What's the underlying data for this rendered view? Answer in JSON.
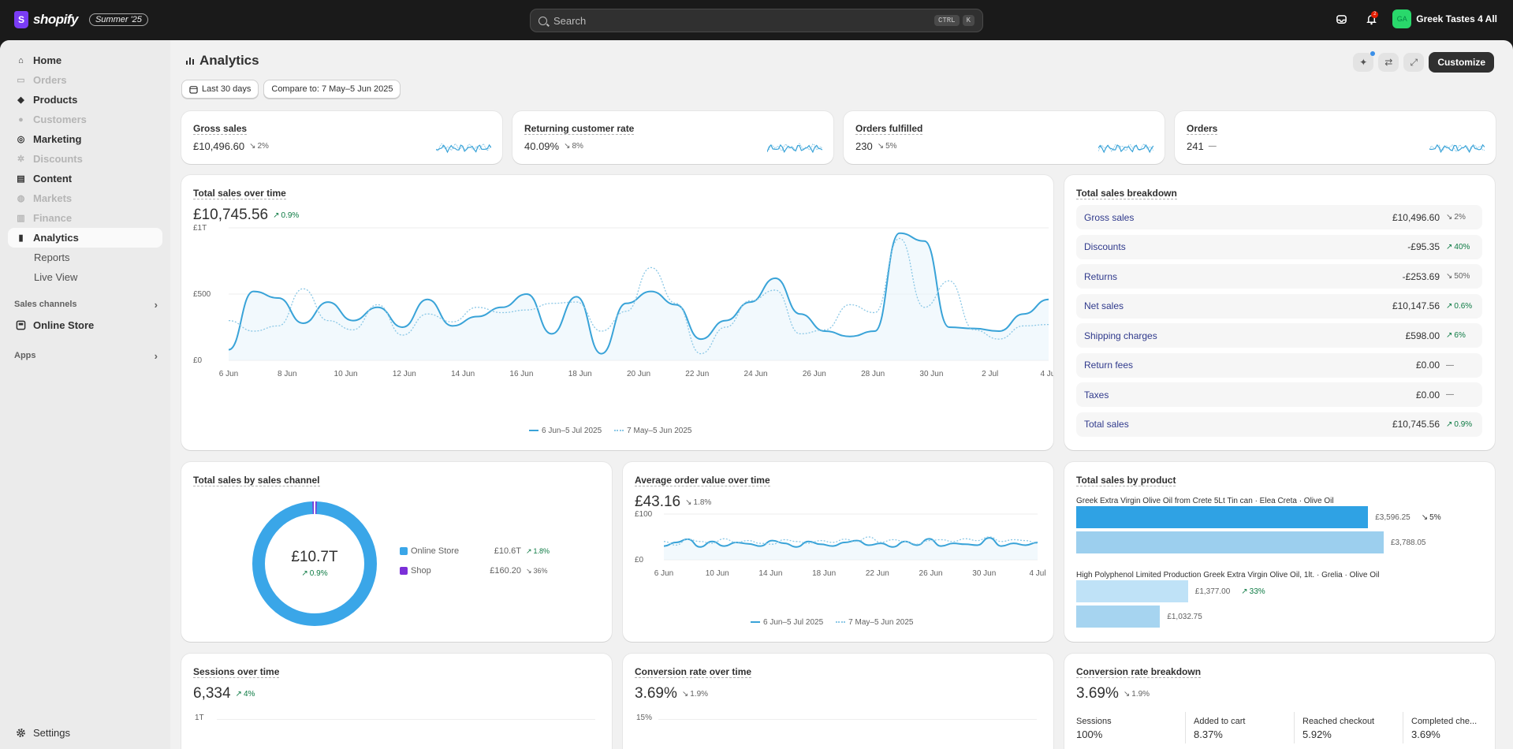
{
  "app": {
    "brand": "shopify",
    "edition": "Summer '25",
    "logo_letter": "S"
  },
  "search": {
    "placeholder": "Search",
    "kbd1": "CTRL",
    "kbd2": "K"
  },
  "topbar": {
    "notif_count": "2",
    "avatar": "GA",
    "store": "Greek Tastes 4 All"
  },
  "sidebar": {
    "items": [
      {
        "label": "Home",
        "icon": "home-icon",
        "dim": false
      },
      {
        "label": "Orders",
        "icon": "orders-icon",
        "dim": true
      },
      {
        "label": "Products",
        "icon": "tag-icon",
        "dim": false
      },
      {
        "label": "Customers",
        "icon": "person-icon",
        "dim": true
      },
      {
        "label": "Marketing",
        "icon": "target-icon",
        "dim": false
      },
      {
        "label": "Discounts",
        "icon": "discount-icon",
        "dim": true
      },
      {
        "label": "Content",
        "icon": "content-icon",
        "dim": false
      },
      {
        "label": "Markets",
        "icon": "globe-icon",
        "dim": true
      },
      {
        "label": "Finance",
        "icon": "bank-icon",
        "dim": true
      },
      {
        "label": "Analytics",
        "icon": "bar-chart-icon",
        "dim": false,
        "active": true
      }
    ],
    "sub": [
      "Reports",
      "Live View"
    ],
    "sales_channels": "Sales channels",
    "online_store": "Online Store",
    "apps": "Apps",
    "settings": "Settings"
  },
  "page": {
    "title": "Analytics",
    "customize": "Customize",
    "date_range": "Last 30 days",
    "compare": "Compare to: 7 May–5 Jun 2025"
  },
  "kpis": [
    {
      "title": "Gross sales",
      "value": "£10,496.60",
      "change": "2%",
      "dir": "down"
    },
    {
      "title": "Returning customer rate",
      "value": "40.09%",
      "change": "8%",
      "dir": "down"
    },
    {
      "title": "Orders fulfilled",
      "value": "230",
      "change": "5%",
      "dir": "down"
    },
    {
      "title": "Orders",
      "value": "241",
      "change": "—",
      "dir": "none"
    }
  ],
  "total_sales": {
    "title": "Total sales over time",
    "value": "£10,745.56",
    "change": "0.9%",
    "y_ticks": [
      "£1T",
      "£500",
      "£0"
    ],
    "x_ticks": [
      "6 Jun",
      "8 Jun",
      "10 Jun",
      "12 Jun",
      "14 Jun",
      "16 Jun",
      "18 Jun",
      "20 Jun",
      "22 Jun",
      "24 Jun",
      "26 Jun",
      "28 Jun",
      "30 Jun",
      "2 Jul",
      "4 Jul"
    ],
    "legend_current": "6 Jun–5 Jul 2025",
    "legend_previous": "7 May–5 Jun 2025"
  },
  "breakdown": {
    "title": "Total sales breakdown",
    "rows": [
      {
        "label": "Gross sales",
        "value": "£10,496.60",
        "change": "2%",
        "dir": "down"
      },
      {
        "label": "Discounts",
        "value": "-£95.35",
        "change": "40%",
        "dir": "up"
      },
      {
        "label": "Returns",
        "value": "-£253.69",
        "change": "50%",
        "dir": "down"
      },
      {
        "label": "Net sales",
        "value": "£10,147.56",
        "change": "0.6%",
        "dir": "up"
      },
      {
        "label": "Shipping charges",
        "value": "£598.00",
        "change": "6%",
        "dir": "up"
      },
      {
        "label": "Return fees",
        "value": "£0.00",
        "change": "—",
        "dir": "none"
      },
      {
        "label": "Taxes",
        "value": "£0.00",
        "change": "—",
        "dir": "none"
      },
      {
        "label": "Total sales",
        "value": "£10,745.56",
        "change": "0.9%",
        "dir": "up"
      }
    ]
  },
  "channel": {
    "title": "Total sales by sales channel",
    "center_value": "£10.7T",
    "center_change": "0.9%",
    "legend": [
      {
        "name": "Online Store",
        "value": "£10.6T",
        "change": "1.8%",
        "dir": "up",
        "color": "#3aa6e8"
      },
      {
        "name": "Shop",
        "value": "£160.20",
        "change": "36%",
        "dir": "down",
        "color": "#7b2fd8"
      }
    ]
  },
  "aov": {
    "title": "Average order value over time",
    "value": "£43.16",
    "change": "1.8%",
    "y_ticks": [
      "£100",
      "£0"
    ],
    "x_ticks": [
      "6 Jun",
      "10 Jun",
      "14 Jun",
      "18 Jun",
      "22 Jun",
      "26 Jun",
      "30 Jun",
      "4 Jul"
    ],
    "legend_current": "6 Jun–5 Jul 2025",
    "legend_previous": "7 May–5 Jun 2025"
  },
  "product": {
    "title": "Total sales by product",
    "items": [
      {
        "name": "Greek Extra Virgin Olive Oil from Crete 5Lt Tin can · Elea Creta · Olive Oil",
        "current": "£3,596.25",
        "change": "5%",
        "previous": "£3,788.05"
      },
      {
        "name": "High Polyphenol Limited Production Greek Extra Virgin Olive Oil, 1lt. · Grelia · Olive Oil",
        "current": "£1,377.00",
        "change": "33%",
        "previous": "£1,032.75"
      }
    ]
  },
  "sessions": {
    "title": "Sessions over time",
    "value": "6,334",
    "change": "4%",
    "y_top": "1T"
  },
  "conversion": {
    "title": "Conversion rate over time",
    "value": "3.69%",
    "change": "1.9%",
    "y_top": "15%"
  },
  "conv_breakdown": {
    "title": "Conversion rate breakdown",
    "value": "3.69%",
    "change": "1.9%",
    "steps": [
      {
        "label": "Sessions",
        "value": "100%"
      },
      {
        "label": "Added to cart",
        "value": "8.37%"
      },
      {
        "label": "Reached checkout",
        "value": "5.92%"
      },
      {
        "label": "Completed che...",
        "value": "3.69%"
      }
    ]
  },
  "chart_data": [
    {
      "type": "line",
      "title": "Total sales over time",
      "x": [
        "6 Jun",
        "8 Jun",
        "10 Jun",
        "12 Jun",
        "14 Jun",
        "16 Jun",
        "18 Jun",
        "20 Jun",
        "22 Jun",
        "24 Jun",
        "26 Jun",
        "28 Jun",
        "30 Jun",
        "2 Jul",
        "4 Jul"
      ],
      "ylim": [
        0,
        1000
      ],
      "series": [
        {
          "name": "6 Jun–5 Jul 2025",
          "values": [
            80,
            520,
            470,
            280,
            440,
            300,
            400,
            250,
            460,
            260,
            330,
            400,
            500,
            200,
            480,
            50,
            430,
            520,
            420,
            160,
            300,
            440,
            620,
            350,
            220,
            180,
            220,
            960,
            900,
            250,
            240,
            220,
            350,
            460
          ]
        },
        {
          "name": "7 May–5 Jun 2025",
          "values": [
            300,
            220,
            260,
            540,
            300,
            230,
            420,
            190,
            350,
            290,
            400,
            360,
            380,
            430,
            440,
            220,
            370,
            700,
            430,
            50,
            250,
            450,
            530,
            200,
            230,
            420,
            360,
            920,
            400,
            600,
            230,
            160,
            260,
            270
          ]
        }
      ]
    },
    {
      "type": "pie",
      "title": "Total sales by sales channel",
      "categories": [
        "Online Store",
        "Shop"
      ],
      "values": [
        10585.36,
        160.2
      ]
    },
    {
      "type": "line",
      "title": "Average order value over time",
      "ylim": [
        0,
        100
      ],
      "series": [
        {
          "name": "6 Jun–5 Jul 2025",
          "values": [
            30,
            38,
            45,
            28,
            40,
            30,
            38,
            35,
            30,
            42,
            36,
            28,
            40,
            34,
            30,
            38,
            42,
            32,
            36,
            28,
            40,
            32,
            46,
            30,
            36,
            34,
            32,
            48,
            30,
            36,
            32,
            38
          ]
        },
        {
          "name": "7 May–5 Jun 2025",
          "values": [
            40,
            32,
            45,
            40,
            36,
            46,
            38,
            42,
            36,
            34,
            44,
            40,
            36,
            42,
            38,
            45,
            40,
            50,
            38,
            44,
            40,
            34,
            42,
            44,
            40,
            46,
            42,
            50,
            40,
            44,
            42,
            36
          ]
        }
      ]
    },
    {
      "type": "bar",
      "title": "Total sales by product",
      "categories": [
        "Greek Extra Virgin Olive Oil from Crete 5Lt Tin can",
        "High Polyphenol Limited Production Greek Extra Virgin Olive Oil, 1lt."
      ],
      "series": [
        {
          "name": "6 Jun–5 Jul 2025",
          "values": [
            3596.25,
            1377.0
          ]
        },
        {
          "name": "7 May–5 Jun 2025",
          "values": [
            3788.05,
            1032.75
          ]
        }
      ]
    }
  ]
}
